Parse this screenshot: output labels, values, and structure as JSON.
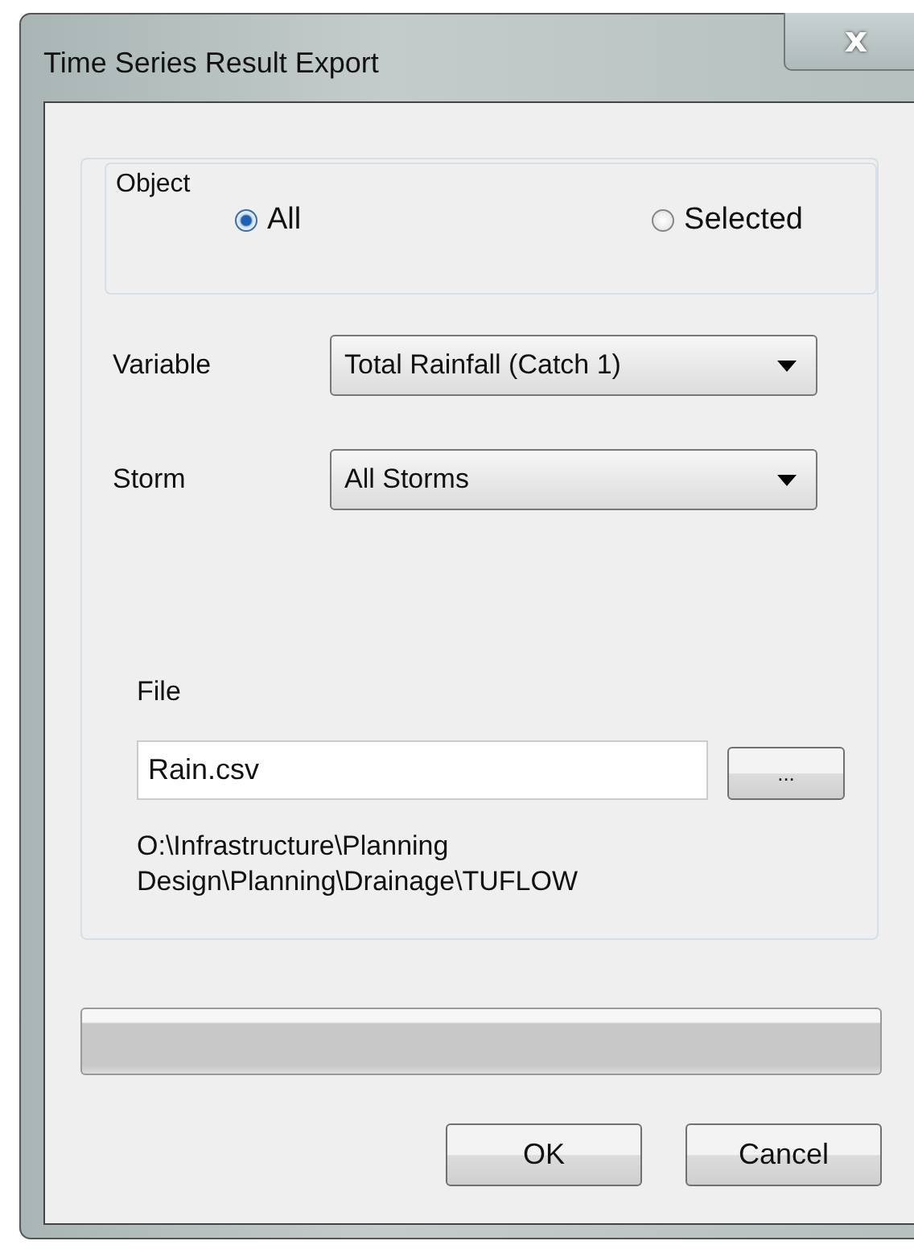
{
  "window": {
    "title": "Time Series Result Export",
    "close": "x"
  },
  "object_group": {
    "legend": "Object",
    "options": [
      {
        "label": "All",
        "selected": true
      },
      {
        "label": "Selected",
        "selected": false
      }
    ]
  },
  "fields": [
    {
      "label": "Variable",
      "value": "Total Rainfall (Catch 1)"
    },
    {
      "label": "Storm",
      "value": "All Storms"
    }
  ],
  "file": {
    "label": "File",
    "value": "Rain.csv",
    "browse": "...",
    "path": [
      "O:\\Infrastructure\\Planning",
      "Design\\Planning\\Drainage\\TUFLOW"
    ]
  },
  "progress": {
    "level": 0
  },
  "buttons": [
    "OK",
    "Cancel"
  ]
}
